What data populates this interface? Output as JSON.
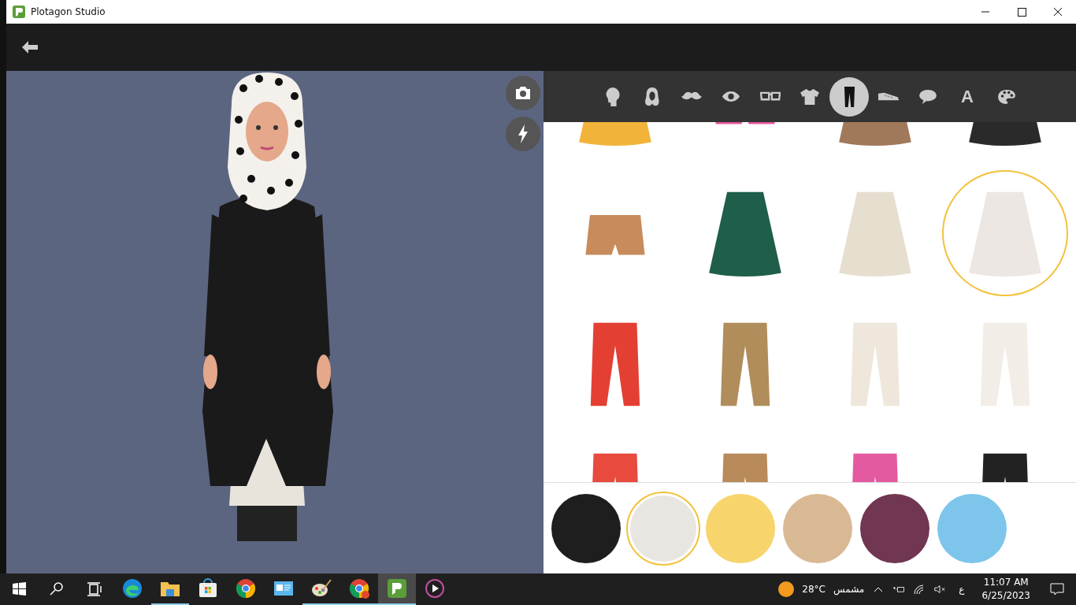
{
  "window": {
    "title": "Plotagon Studio"
  },
  "categories": [
    {
      "kind": "head",
      "selected": false
    },
    {
      "kind": "hair",
      "selected": false
    },
    {
      "kind": "mustache",
      "selected": false
    },
    {
      "kind": "eye",
      "selected": false
    },
    {
      "kind": "glasses",
      "selected": false
    },
    {
      "kind": "shirt",
      "selected": false
    },
    {
      "kind": "pants",
      "selected": true
    },
    {
      "kind": "shoe",
      "selected": false
    },
    {
      "kind": "speech",
      "selected": false
    },
    {
      "kind": "text",
      "label": "A",
      "selected": false
    },
    {
      "kind": "palette",
      "selected": false
    }
  ],
  "items": [
    {
      "kind": "skirt",
      "color": "#f2b33a",
      "selected": false
    },
    {
      "kind": "shorts",
      "color": "#e6559a",
      "selected": false
    },
    {
      "kind": "skirt",
      "color": "#a0785a",
      "selected": false
    },
    {
      "kind": "skirt",
      "color": "#2a2a2a",
      "selected": false
    },
    {
      "kind": "shorts",
      "color": "#c88b5b",
      "selected": false
    },
    {
      "kind": "skirt",
      "color": "#1e5e4a",
      "selected": false
    },
    {
      "kind": "skirt",
      "color": "#e6dfd0",
      "selected": false
    },
    {
      "kind": "skirt",
      "color": "#ece7e2",
      "selected": true
    },
    {
      "kind": "pants",
      "color": "#e43f33",
      "selected": false
    },
    {
      "kind": "pants",
      "color": "#b18d5b",
      "selected": false
    },
    {
      "kind": "pants",
      "color": "#efe7dc",
      "selected": false
    },
    {
      "kind": "pants",
      "color": "#f2ede6",
      "selected": false
    },
    {
      "kind": "pants",
      "color": "#e84a3e",
      "selected": false
    },
    {
      "kind": "pants",
      "color": "#b98a5a",
      "selected": false
    },
    {
      "kind": "pants",
      "color": "#e45aa0",
      "selected": false
    },
    {
      "kind": "pants",
      "color": "#222222",
      "selected": false
    }
  ],
  "swatches": [
    {
      "color": "#1e1e1e",
      "selected": false
    },
    {
      "color": "#e9e5e0",
      "selected": true
    },
    {
      "color": "#f8d46c",
      "selected": false
    },
    {
      "color": "#d9b994",
      "selected": false
    },
    {
      "color": "#713652",
      "selected": false
    },
    {
      "color": "#7dc5ea",
      "selected": false
    }
  ],
  "taskbar": {
    "apps": [
      {
        "kind": "edge",
        "running": false,
        "selected": false
      },
      {
        "kind": "folder",
        "running": true,
        "selected": false
      },
      {
        "kind": "store",
        "running": false,
        "selected": false
      },
      {
        "kind": "chrome",
        "running": false,
        "selected": false
      },
      {
        "kind": "panel",
        "running": false,
        "selected": false
      },
      {
        "kind": "paint",
        "running": true,
        "selected": false
      },
      {
        "kind": "chrome-m",
        "running": true,
        "selected": false
      },
      {
        "kind": "plotagon",
        "running": true,
        "selected": true
      },
      {
        "kind": "player",
        "running": false,
        "selected": false
      }
    ],
    "temperature": "28°C",
    "weather": "مشمس",
    "language": "ع",
    "time": "11:07 AM",
    "date": "6/25/2023"
  }
}
